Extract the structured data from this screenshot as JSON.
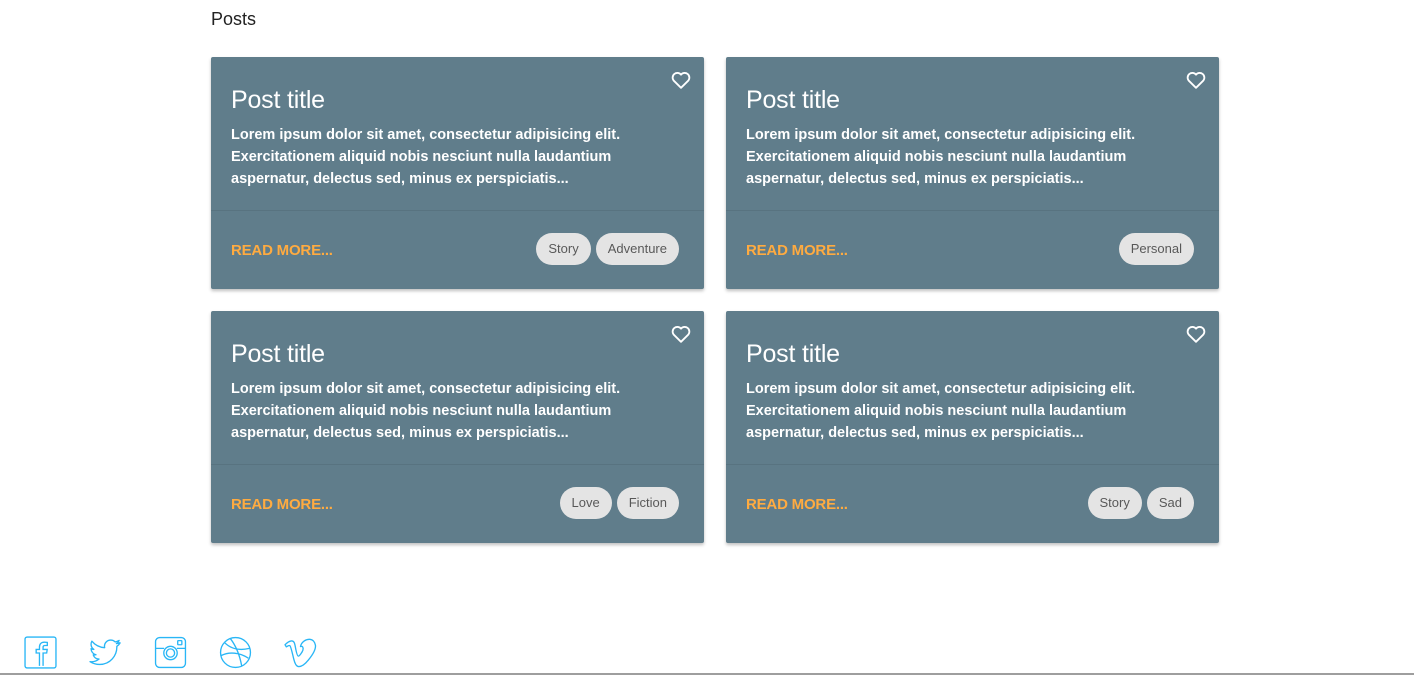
{
  "page": {
    "title": "Posts"
  },
  "posts": [
    {
      "title": "Post title",
      "excerpt": "Lorem ipsum dolor sit amet, consectetur adipisicing elit. Exercitationem aliquid nobis nesciunt nulla laudantium aspernatur, delectus sed, minus ex perspiciatis...",
      "read_more": "READ MORE...",
      "tags": [
        "Story",
        "Adventure"
      ]
    },
    {
      "title": "Post title",
      "excerpt": "Lorem ipsum dolor sit amet, consectetur adipisicing elit. Exercitationem aliquid nobis nesciunt nulla laudantium aspernatur, delectus sed, minus ex perspiciatis...",
      "read_more": "READ MORE...",
      "tags": [
        "Personal"
      ]
    },
    {
      "title": "Post title",
      "excerpt": "Lorem ipsum dolor sit amet, consectetur adipisicing elit. Exercitationem aliquid nobis nesciunt nulla laudantium aspernatur, delectus sed, minus ex perspiciatis...",
      "read_more": "READ MORE...",
      "tags": [
        "Love",
        "Fiction"
      ]
    },
    {
      "title": "Post title",
      "excerpt": "Lorem ipsum dolor sit amet, consectetur adipisicing elit. Exercitationem aliquid nobis nesciunt nulla laudantium aspernatur, delectus sed, minus ex perspiciatis...",
      "read_more": "READ MORE...",
      "tags": [
        "Story",
        "Sad"
      ]
    }
  ],
  "social": {
    "icons": [
      "facebook-icon",
      "twitter-icon",
      "instagram-icon",
      "dribbble-icon",
      "vimeo-icon"
    ]
  },
  "colors": {
    "card_bg": "#607d8b",
    "accent": "#ffab40",
    "chip_bg": "#e4e4e4",
    "social_icon": "#29b6f6"
  }
}
